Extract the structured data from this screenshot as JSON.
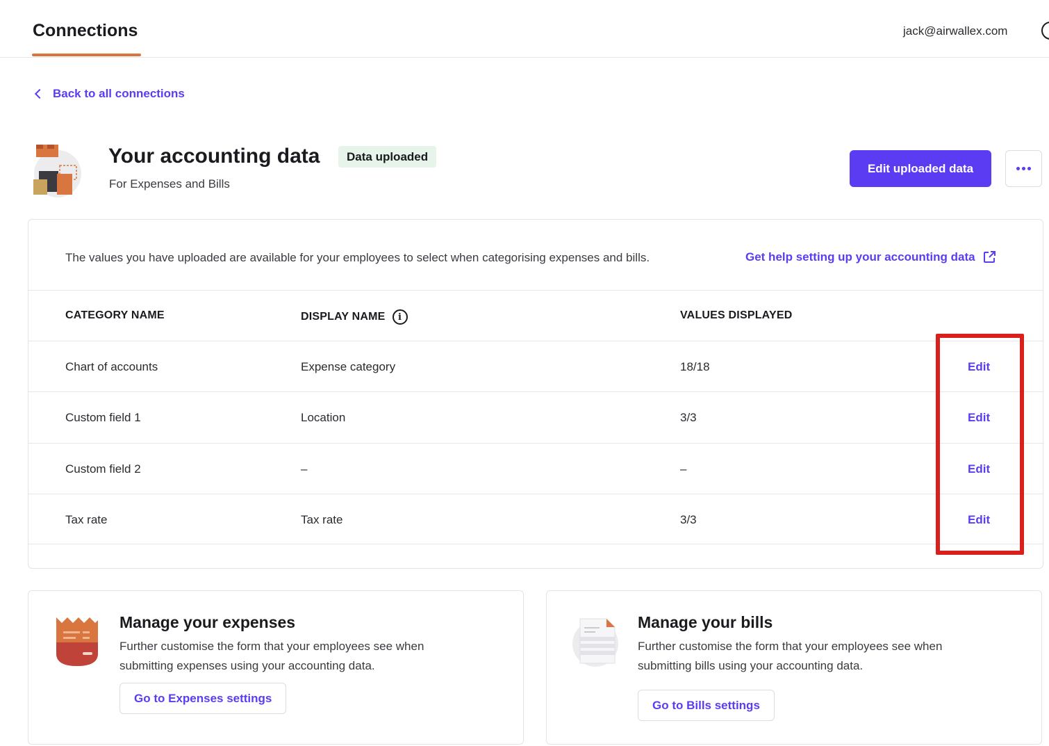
{
  "topbar": {
    "title": "Connections",
    "user_email": "jack@airwallex.com"
  },
  "back_link": {
    "label": "Back to all connections"
  },
  "header": {
    "title": "Your accounting data",
    "badge": "Data uploaded",
    "subtitle": "For Expenses and Bills",
    "primary_button": "Edit uploaded data"
  },
  "card": {
    "intro": "The values you have uploaded are available for your employees to select when categorising expenses and bills.",
    "help_link": "Get help setting up your accounting data",
    "columns": [
      "CATEGORY NAME",
      "DISPLAY NAME",
      "VALUES DISPLAYED"
    ],
    "rows": [
      {
        "category": "Chart of accounts",
        "display": "Expense category",
        "values": "18/18",
        "action": "Edit"
      },
      {
        "category": "Custom field 1",
        "display": "Location",
        "values": "3/3",
        "action": "Edit"
      },
      {
        "category": "Custom field 2",
        "display": "–",
        "values": "–",
        "action": "Edit"
      },
      {
        "category": "Tax rate",
        "display": "Tax rate",
        "values": "3/3",
        "action": "Edit"
      }
    ]
  },
  "expenses_card": {
    "title": "Manage your expenses",
    "description": "Further customise the form that your employees see when submitting expenses using your accounting data.",
    "button": "Go to Expenses settings"
  },
  "bills_card": {
    "title": "Manage your bills",
    "description": "Further customise the form that your employees see when submitting bills using your accounting data.",
    "button": "Go to Bills settings"
  },
  "colors": {
    "accent": "#5b3cf2",
    "tab_underline": "#d9763f",
    "badge_bg": "#e6f4ea",
    "highlight": "#d8201c"
  },
  "icons": {
    "back": "chevron-left-icon",
    "more": "more-horizontal-icon",
    "external": "external-link-icon",
    "info": "info-icon",
    "user": "user-circle-icon"
  }
}
